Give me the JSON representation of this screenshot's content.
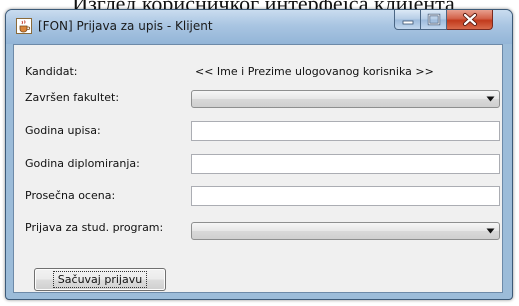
{
  "caption": "Изглед корисничког интерфејса клијента",
  "window": {
    "title": "[FON] Prijava za upis - Klijent",
    "app_icon": "java-cup-icon",
    "controls": [
      "minimize-icon",
      "maximize-icon",
      "close-icon"
    ]
  },
  "form": {
    "kandidat_label": "Kandidat:",
    "kandidat_value": "<< Ime i Prezime ulogovanog korisnika >>",
    "fakultet_label": "Završen fakultet:",
    "fakultet_value": "",
    "godina_upisa_label": "Godina upisa:",
    "godina_upisa_value": "",
    "godina_diplomiranja_label": "Godina diplomiranja:",
    "godina_diplomiranja_value": "",
    "prosecna_ocena_label": "Prosečna ocena:",
    "prosecna_ocena_value": "",
    "program_label": "Prijava za stud. program:",
    "program_value": "",
    "save_label": "Sačuvaj prijavu"
  }
}
